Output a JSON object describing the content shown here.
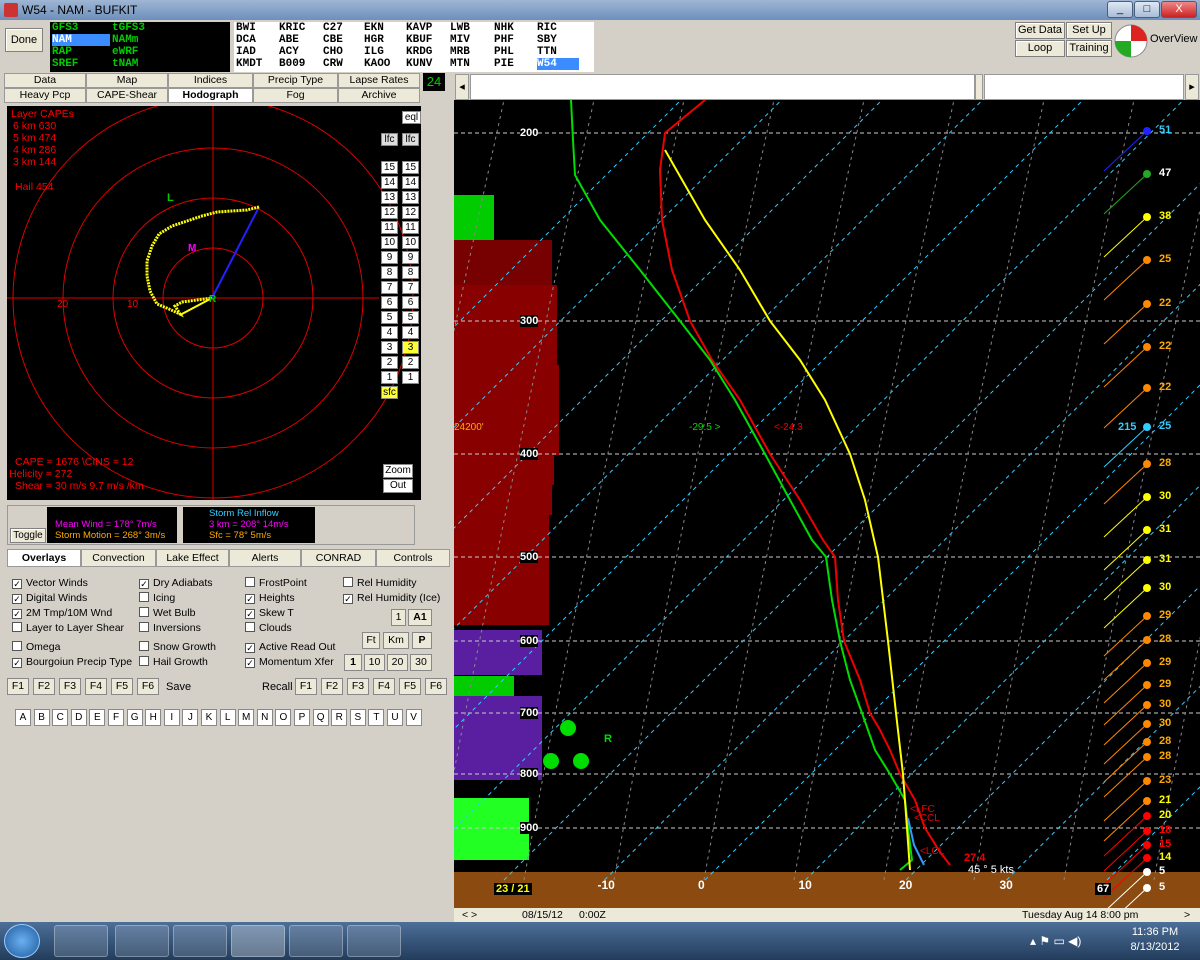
{
  "window": {
    "title": "W54 - NAM - BUFKIT",
    "min": "_",
    "max": "□",
    "close": "X"
  },
  "toolbar": {
    "done": "Done",
    "models": [
      [
        "GFS3",
        "tGFS3"
      ],
      [
        "NAM",
        "NAMm"
      ],
      [
        "RAP",
        "eWRF"
      ],
      [
        "SREF",
        "tNAM"
      ]
    ],
    "stations": [
      [
        "BWI",
        "KRIC",
        "C27",
        "EKN",
        "KAVP",
        "LWB",
        "NHK",
        "RIC"
      ],
      [
        "DCA",
        "ABE",
        "CBE",
        "HGR",
        "KBUF",
        "MIV",
        "PHF",
        "SBY"
      ],
      [
        "IAD",
        "ACY",
        "CHO",
        "ILG",
        "KRDG",
        "MRB",
        "PHL",
        "TTN"
      ],
      [
        "KMDT",
        "B009",
        "CRW",
        "KAOO",
        "KUNV",
        "MTN",
        "PIE",
        "W54"
      ]
    ],
    "get_data": "Get Data",
    "set_up": "Set Up",
    "loop": "Loop",
    "training": "Training",
    "overview": "OverView"
  },
  "tabs_row1": [
    "Data",
    "Map",
    "Indices",
    "Precip Type",
    "Lapse Rates"
  ],
  "tabs_row2": [
    "Heavy Pcp",
    "CAPE-Shear",
    "Hodograph",
    "Fog",
    "Archive"
  ],
  "hour_box": "24",
  "hodo": {
    "layer_capes_title": "Layer CAPEs",
    "capes": [
      "6 km  630",
      "5 km  474",
      "4 km  286",
      "3 km  144"
    ],
    "hail": "Hail  454",
    "ring20": "20",
    "ring10": "10",
    "L": "L",
    "M": "M",
    "R": "R",
    "cape_line": "CAPE = 1676 \\CINS =  12",
    "helicity": "Helicity = 272",
    "shear": "Shear = 30 m/s    9.7 m/s /km",
    "eql": "eql",
    "lfc": "lfc",
    "levels": [
      "15",
      "14",
      "13",
      "12",
      "11",
      "10",
      "9",
      "8",
      "7",
      "6",
      "5",
      "4",
      "3",
      "2",
      "1"
    ],
    "sfc": "sfc",
    "zoom": "Zoom",
    "out": "Out"
  },
  "motion": {
    "toggle": "Toggle",
    "mean_wind": "Mean Wind = 178°  7m/s",
    "storm_motion": "Storm Motion = 268°  3m/s",
    "sri_title": "Storm Rel Inflow",
    "sri_3km": "3 km = 208°  14m/s",
    "sri_sfc": "Sfc = 78°  5m/s"
  },
  "subtabs": [
    "Overlays",
    "Convection",
    "Lake Effect",
    "Alerts",
    "CONRAD",
    "Controls"
  ],
  "overlays": {
    "col1": [
      [
        "Vector Winds",
        true
      ],
      [
        "Digital Winds",
        true
      ],
      [
        "2M Tmp/10M Wnd",
        true
      ],
      [
        "Layer to Layer Shear",
        false
      ],
      [
        "Omega",
        false
      ],
      [
        "Bourgoiun Precip Type",
        true
      ]
    ],
    "col2": [
      [
        "Dry Adiabats",
        true
      ],
      [
        "Icing",
        false
      ],
      [
        "Wet Bulb",
        false
      ],
      [
        "Inversions",
        false
      ],
      [
        "Snow Growth",
        false
      ],
      [
        "Hail Growth",
        false
      ]
    ],
    "col3": [
      [
        "FrostPoint",
        false
      ],
      [
        "Heights",
        true
      ],
      [
        "Skew T",
        true
      ],
      [
        "Clouds",
        false
      ],
      [
        "Active Read Out",
        true
      ],
      [
        "Momentum Xfer",
        true
      ]
    ],
    "col4": [
      [
        "Rel Humidity",
        false
      ],
      [
        "Rel Humidity (Ice)",
        true
      ]
    ],
    "small": {
      "one": "1",
      "a1": "A1",
      "ft": "Ft",
      "km": "Km",
      "p": "P",
      "n1": "1",
      "n10": "10",
      "n20": "20",
      "n30": "30"
    }
  },
  "fkeys": {
    "keys": [
      "F1",
      "F2",
      "F3",
      "F4",
      "F5",
      "F6"
    ],
    "save": "Save",
    "recall": "Recall"
  },
  "letters": [
    "A",
    "B",
    "C",
    "D",
    "E",
    "F",
    "G",
    "H",
    "I",
    "J",
    "K",
    "L",
    "M",
    "N",
    "O",
    "P",
    "Q",
    "R",
    "S",
    "T",
    "U",
    "V"
  ],
  "skewt": {
    "pressures": [
      "200",
      "300",
      "400",
      "500",
      "600",
      "700",
      "800",
      "900"
    ],
    "temps": [
      "-10",
      "0",
      "10",
      "20",
      "30"
    ],
    "height": "24200'",
    "wb_temp": "-29.5 >",
    "t_temp": "<-24.3",
    "lfc": "<LFC",
    "ccl": "<CCL",
    "lcl": "<LCL",
    "sfc_temp": "27.4",
    "sfc_wind": "45 ° 5 kts",
    "corner_left": "23 / 21",
    "corner_right": "67",
    "winds": [
      "51",
      "47",
      "38",
      "25",
      "22",
      "22",
      "22",
      "25",
      "28",
      "30",
      "31",
      "31",
      "30",
      "29",
      "28",
      "29",
      "29",
      "30",
      "30",
      "28",
      "28",
      "23",
      "21",
      "20",
      "18",
      "15",
      "14",
      "5",
      "5"
    ],
    "wind_label_215": "215",
    "R": "R"
  },
  "status": {
    "date": "08/15/12",
    "time": "0:00Z",
    "local": "Tuesday   Aug 14  8:00 pm"
  },
  "taskbar": {
    "clock": "11:36 PM",
    "date": "8/13/2012"
  }
}
